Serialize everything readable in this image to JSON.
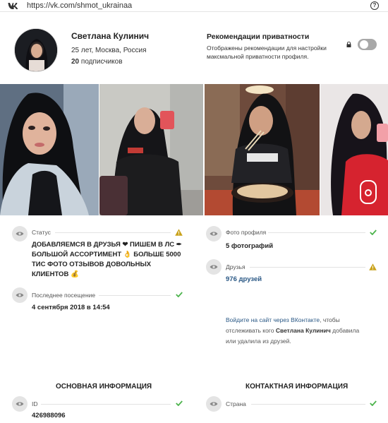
{
  "browser": {
    "url": "https://vk.com/shmot_ukrainaa",
    "vk_logo": "vk-logo-icon",
    "help": "?"
  },
  "profile": {
    "name": "Светлана Кулинич",
    "age_city": "25 лет, Москва, Россия",
    "subscribers_count": "20",
    "subscribers_label": "подписчиков"
  },
  "privacy": {
    "title": "Рекомендации приватности",
    "description": "Отображены рекомендации для настройки максмальной приватности профиля.",
    "toggle_on": false
  },
  "status": {
    "label": "Статус",
    "text": "ДОБАВЛЯЕМСЯ В ДРУЗЬЯ ❤ ПИШЕМ В ЛС ✒ БОЛЬШОЙ АССОРТИМЕНТ 👌 БОЛЬШЕ 5000 ТИС ФОТО ОТЗЫВОВ ДОВОЛЬНЫХ КЛИЕНТОВ 💰"
  },
  "last_seen": {
    "label": "Последнее посещение",
    "value": "4 сентября 2018 в 14:54"
  },
  "profile_photo": {
    "label": "Фото профиля",
    "value": "5 фотографий"
  },
  "friends": {
    "label": "Друзья",
    "value": "976 друзей"
  },
  "login_note": {
    "link": "Войдите на сайт через ВКонтакте",
    "text1": ", чтобы отслеживать кого ",
    "name": "Светлана Кулинич",
    "text2": " добавила или удалила из друзей."
  },
  "sections": {
    "main": "ОСНОВНАЯ ИНФОРМАЦИЯ",
    "contact": "КОНТАКТНАЯ ИНФОРМАЦИЯ"
  },
  "id_row": {
    "label": "ID",
    "value": "426988096"
  },
  "country_row": {
    "label": "Страна"
  },
  "colors": {
    "check": "#4bb34b",
    "warning": "#c9a21b",
    "link": "#2a5885",
    "toggle_off": "#a8a8a8"
  }
}
